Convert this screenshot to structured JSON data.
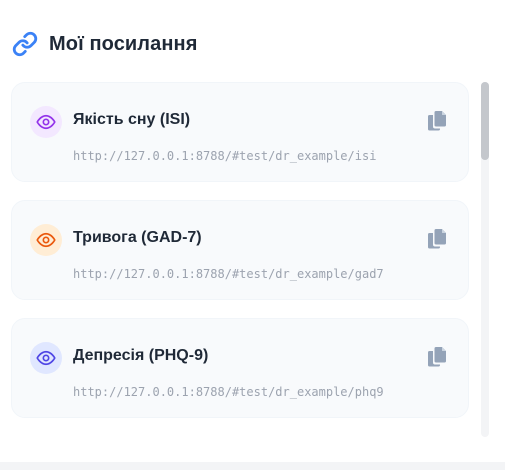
{
  "header": {
    "title": "Мої посилання",
    "icon": "link-icon",
    "icon_color": "#3b82f6"
  },
  "links": [
    {
      "title": "Якість сну (ISI)",
      "url": "http://127.0.0.1:8788/#test/dr_example/isi",
      "icon": "eye-icon",
      "icon_color": "#9333ea",
      "icon_bg": "#f3e8ff"
    },
    {
      "title": "Тривога (GAD-7)",
      "url": "http://127.0.0.1:8788/#test/dr_example/gad7",
      "icon": "eye-icon",
      "icon_color": "#ea580c",
      "icon_bg": "#ffedd5"
    },
    {
      "title": "Депресія (PHQ-9)",
      "url": "http://127.0.0.1:8788/#test/dr_example/phq9",
      "icon": "eye-icon",
      "icon_color": "#4f46e5",
      "icon_bg": "#e0e7ff"
    }
  ],
  "copy_icon": "copy-icon",
  "copy_icon_color": "#94a3b8"
}
